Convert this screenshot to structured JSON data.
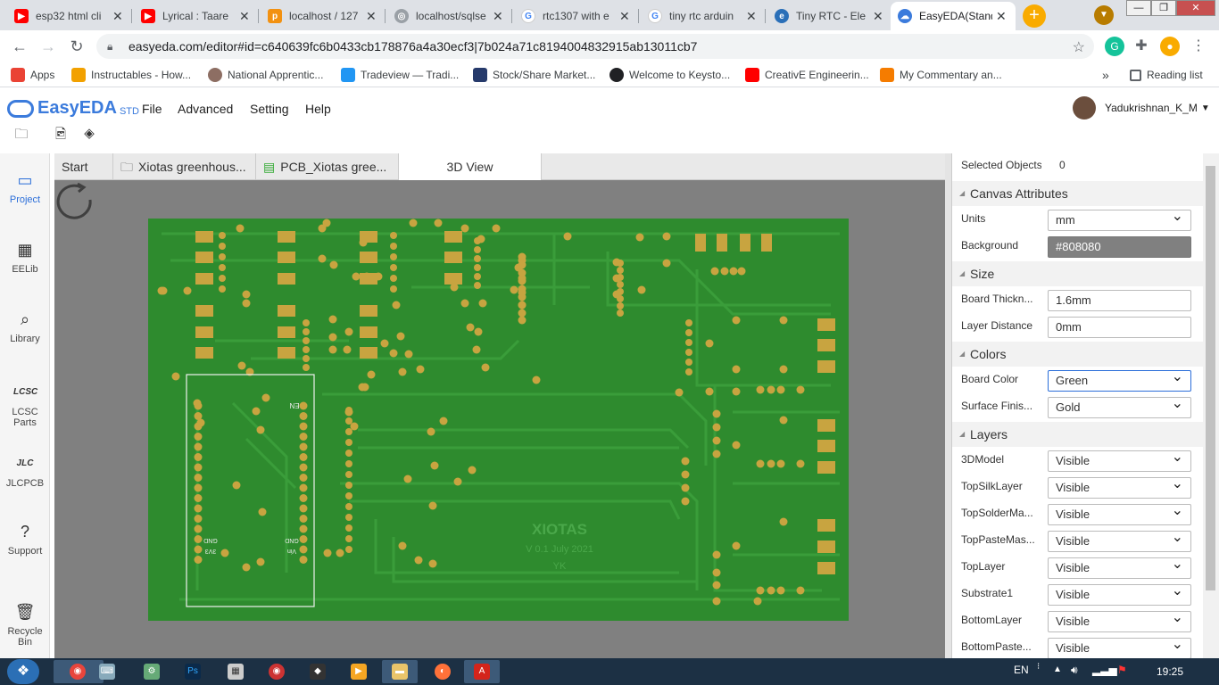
{
  "browser": {
    "tabs": [
      {
        "title": "esp32 html cli",
        "icon": "youtube-icon",
        "color": "#ff0000"
      },
      {
        "title": "Lyrical : Taare",
        "icon": "youtube-icon",
        "color": "#ff0000"
      },
      {
        "title": "localhost / 127",
        "icon": "phpmyadmin-icon",
        "color": "#f29111"
      },
      {
        "title": "localhost/sqlse",
        "icon": "globe-icon",
        "color": "#5f6368"
      },
      {
        "title": "rtc1307 with e",
        "icon": "google-icon",
        "color": "#4285f4"
      },
      {
        "title": "tiny rtc arduin",
        "icon": "google-icon",
        "color": "#4285f4"
      },
      {
        "title": "Tiny RTC - Ele",
        "icon": "electronics-icon",
        "color": "#2a6fb8"
      },
      {
        "title": "EasyEDA(Stand",
        "icon": "easyeda-icon",
        "color": "#3b7bdc"
      }
    ],
    "new_tab_label": "+",
    "url": "easyeda.com/editor#id=c640639fc6b0433cb178876a4a30ecf3|7b024a71c8194004832915ab13011cb7",
    "bookmarks": [
      {
        "label": "Apps",
        "color": "#ea4335"
      },
      {
        "label": "Instructables - How...",
        "color": "#f2a100"
      },
      {
        "label": "National Apprentic...",
        "color": "#8d6e63"
      },
      {
        "label": "Tradeview — Tradi...",
        "color": "#2196f3"
      },
      {
        "label": "Stock/Share Market...",
        "color": "#263a6b"
      },
      {
        "label": "Welcome to Keysto...",
        "color": "#202124"
      },
      {
        "label": "CreativE Engineerin...",
        "color": "#ff0000"
      },
      {
        "label": "My Commentary an...",
        "color": "#f57c00"
      }
    ],
    "more_bookmarks": "»",
    "reading_list": "Reading list"
  },
  "app": {
    "logo": "EasyEDA",
    "edition": "STD",
    "menu": [
      "File",
      "Advanced",
      "Setting",
      "Help"
    ],
    "user": "Yadukrishnan_K_M"
  },
  "sidebar": [
    {
      "label": "Project",
      "icon": "project-icon",
      "active": true
    },
    {
      "label": "EELib",
      "icon": "chip-icon",
      "active": false
    },
    {
      "label": "Library",
      "icon": "library-search-icon",
      "active": false
    },
    {
      "label": "LCSC Parts",
      "icon": "lcsc-icon",
      "active": false
    },
    {
      "label": "JLCPCB",
      "icon": "jlcpcb-icon",
      "active": false
    },
    {
      "label": "Support",
      "icon": "help-icon",
      "active": false
    },
    {
      "label": "Recycle Bin",
      "icon": "trash-icon",
      "active": false
    }
  ],
  "doc_tabs": [
    {
      "label": "Start"
    },
    {
      "label": "Xiotas greenhous..."
    },
    {
      "label": "PCB_Xiotas gree..."
    },
    {
      "label": "3D View"
    }
  ],
  "pcb": {
    "brand": "XIOTAS",
    "version": "V 0.1 July 2021",
    "author": "YK",
    "silk_en": "EN",
    "silk_gnd_left": "GND",
    "silk_3v3": "3V3",
    "silk_gnd_right": "GND",
    "silk_vin": "Vin",
    "board_color": "#2e8b2e",
    "pad_color": "#c8a440",
    "canvas_bg": "#808080"
  },
  "panel": {
    "selected_label": "Selected Objects",
    "selected_count": "0",
    "sections": {
      "canvas": "Canvas Attributes",
      "size": "Size",
      "colors": "Colors",
      "layers": "Layers"
    },
    "units_label": "Units",
    "units_value": "mm",
    "background_label": "Background",
    "background_value": "#808080",
    "board_thickness_label": "Board Thickn...",
    "board_thickness_value": "1.6mm",
    "layer_distance_label": "Layer Distance",
    "layer_distance_value": "0mm",
    "board_color_label": "Board Color",
    "board_color_value": "Green",
    "surface_finish_label": "Surface Finis...",
    "surface_finish_value": "Gold",
    "layers": [
      {
        "name": "3DModel",
        "value": "Visible"
      },
      {
        "name": "TopSilkLayer",
        "value": "Visible"
      },
      {
        "name": "TopSolderMa...",
        "value": "Visible"
      },
      {
        "name": "TopPasteMas...",
        "value": "Visible"
      },
      {
        "name": "TopLayer",
        "value": "Visible"
      },
      {
        "name": "Substrate1",
        "value": "Visible"
      },
      {
        "name": "BottomLayer",
        "value": "Visible"
      },
      {
        "name": "BottomPaste...",
        "value": "Visible"
      }
    ]
  },
  "taskbar": {
    "lang": "EN",
    "time": "19:25"
  }
}
